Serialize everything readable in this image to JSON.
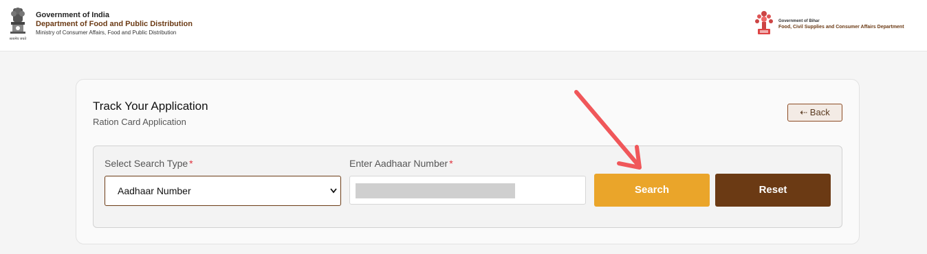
{
  "header": {
    "title": "Government of India",
    "department": "Department of Food and Public Distribution",
    "ministry": "Ministry of Consumer Affairs, Food and Public Distribution",
    "emblem_caption": "सत्यमेव जयते",
    "right_govt": "Government of Bihar",
    "right_dept": "Food, Civil Supplies and Consumer Affairs Department"
  },
  "card": {
    "title": "Track Your Application",
    "subtitle": "Ration Card Application",
    "back_label": "⇠ Back"
  },
  "form": {
    "search_type_label": "Select Search Type",
    "search_type_value": "Aadhaar Number",
    "aadhaar_label": "Enter Aadhaar Number",
    "required_mark": "*",
    "search_label": "Search",
    "reset_label": "Reset"
  },
  "colors": {
    "brand_brown": "#6b3a14",
    "search_orange": "#eaa52a",
    "required_red": "#e0303a",
    "annotation_arrow": "#f0575a"
  },
  "icons": {
    "emblem": "india-emblem-icon",
    "bihar_logo": "bihar-seal-icon",
    "select_chevron": "chevron-down-icon",
    "annotation": "arrow-pointer-icon"
  }
}
